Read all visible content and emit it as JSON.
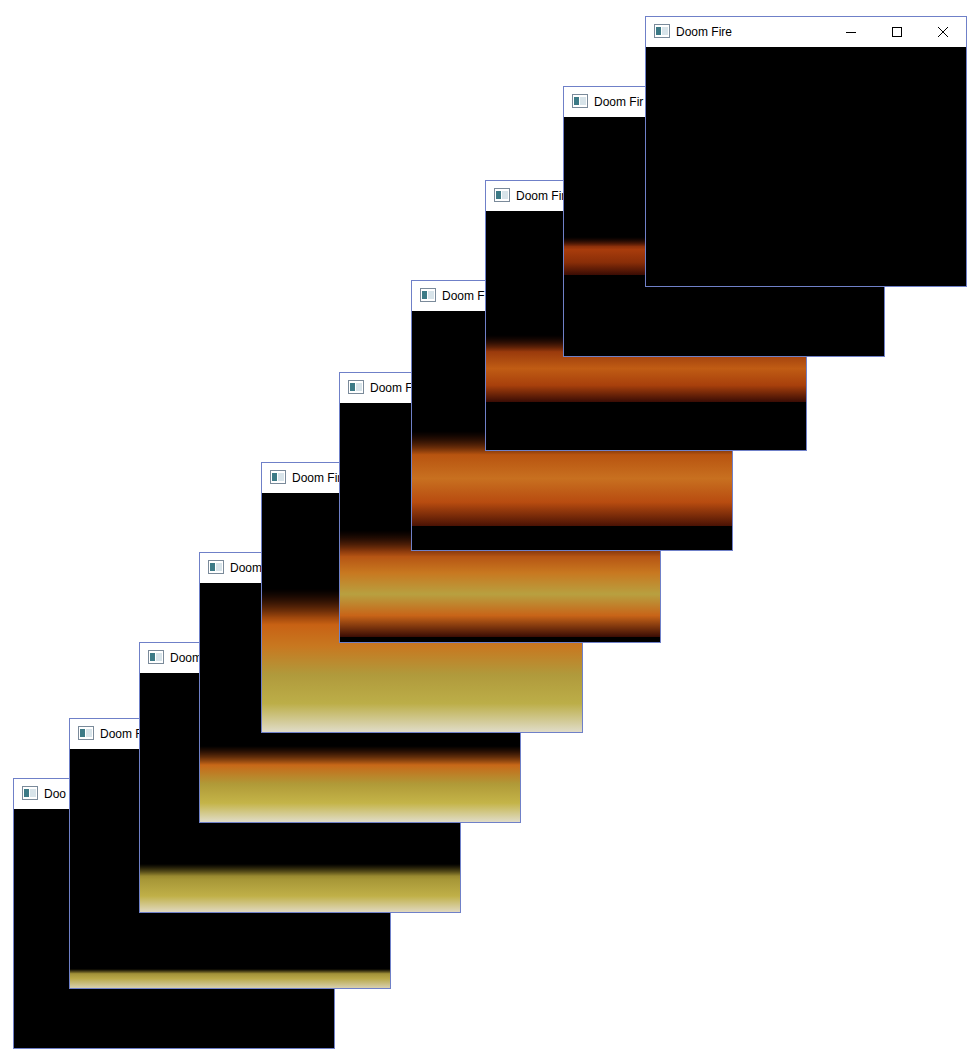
{
  "windows": [
    {
      "title": "Doo",
      "fire": {
        "bottom": 0,
        "top": 0,
        "colors": []
      }
    },
    {
      "title": "Doom F",
      "fire": {
        "bottom": 0,
        "top": 0.08,
        "colors": [
          "#d8d0b0",
          "#b8a848",
          "#8a7a28"
        ]
      }
    },
    {
      "title": "Doom",
      "fire": {
        "bottom": 0,
        "top": 0.2,
        "colors": [
          "#e0d8c0",
          "#c0b048",
          "#a89838",
          "#6a5a18"
        ]
      }
    },
    {
      "title": "Doom",
      "fire": {
        "bottom": 0,
        "top": 0.32,
        "colors": [
          "#e0dcc8",
          "#c4b448",
          "#b09a38",
          "#c86818",
          "#7a2a08"
        ]
      }
    },
    {
      "title": "Doom Fir",
      "fire": {
        "bottom": 0,
        "top": 0.6,
        "colors": [
          "#e0dcc8",
          "#bcae48",
          "#b09a3c",
          "#c87820",
          "#c85a10",
          "#6a1e06"
        ]
      }
    },
    {
      "title": "Doom Fir",
      "fire": {
        "bottom": 0.02,
        "top": 0.47,
        "colors": [
          "#3a0c04",
          "#c86418",
          "#b8a040",
          "#c87820",
          "#b04a10",
          "#4a1204"
        ]
      }
    },
    {
      "title": "Doom Fir",
      "fire": {
        "bottom": 0.1,
        "top": 0.5,
        "colors": [
          "#4a1204",
          "#b84c10",
          "#c87020",
          "#b85410",
          "#4a1204"
        ]
      }
    },
    {
      "title": "Doom Fir",
      "fire": {
        "bottom": 0.2,
        "top": 0.48,
        "colors": [
          "#3a0c04",
          "#a8400c",
          "#c05c14",
          "#9a3a0c",
          "#3a0c04"
        ]
      }
    },
    {
      "title": "Doom Fir",
      "fire": {
        "bottom": 0.34,
        "top": 0.5,
        "colors": [
          "#3a0c04",
          "#8a2e08",
          "#a83c0c",
          "#3a0c04"
        ]
      }
    },
    {
      "title": "Doom Fire",
      "fire": {
        "bottom": 0,
        "top": 0,
        "colors": []
      }
    }
  ]
}
